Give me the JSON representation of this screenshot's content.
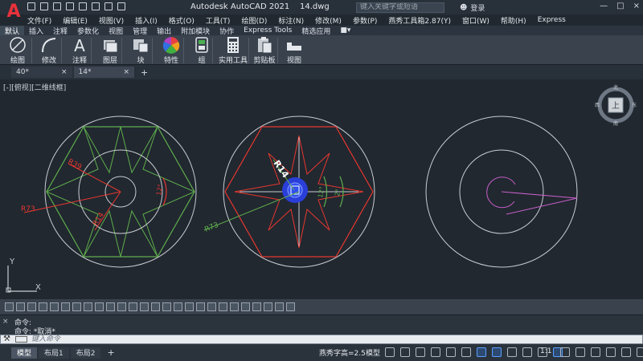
{
  "window": {
    "app_title": "Autodesk AutoCAD 2021",
    "file_name": "14.dwg",
    "search_placeholder": "键入关键字或短语",
    "login_label": "登录",
    "controls": [
      "—",
      "□",
      "×"
    ]
  },
  "menu": [
    "文件(F)",
    "编辑(E)",
    "视图(V)",
    "插入(I)",
    "格式(O)",
    "工具(T)",
    "绘图(D)",
    "标注(N)",
    "修改(M)",
    "参数(P)",
    "燕秀工具箱2.87(Y)",
    "窗口(W)",
    "帮助(H)",
    "Express"
  ],
  "ribbon_tabs": [
    "默认",
    "插入",
    "注释",
    "参数化",
    "视图",
    "管理",
    "输出",
    "附加模块",
    "协作",
    "Express Tools",
    "精选应用"
  ],
  "ribbon_tools": [
    "绘图",
    "修改",
    "注释",
    "图层",
    "块",
    "特性",
    "组",
    "实用工具",
    "剪贴板",
    "视图"
  ],
  "doc_tabs": [
    {
      "label": "40*"
    },
    {
      "label": "14*"
    }
  ],
  "viewport": {
    "label": "[-][俯视][二维线框]",
    "viewcube": {
      "top": "上",
      "north": "北",
      "south": "南",
      "east": "东",
      "west": "西"
    },
    "ucs": {
      "x": "X",
      "y": "Y"
    }
  },
  "dimensions": {
    "left": {
      "r73": "R73",
      "r39": "R39",
      "r14": "R14",
      "a12": "12°"
    },
    "middle": {
      "r14": "R14",
      "r73": "R73",
      "a12": "12°",
      "a2": "2°"
    }
  },
  "command": {
    "history": [
      "命令:",
      "命令: *取消*"
    ],
    "placeholder": "键入命令"
  },
  "layout_tabs": [
    "模型",
    "布局1",
    "布局2"
  ],
  "status": {
    "text_height": "燕秀字高=2.5",
    "model": "模型",
    "scale": "1:1"
  },
  "colors": {
    "background": "#212830",
    "green": "#5fae4c",
    "red": "#e8372f",
    "white_line": "#c8ccd0",
    "magenta": "#c85fc8",
    "blue_grip": "#2a3fd8"
  }
}
